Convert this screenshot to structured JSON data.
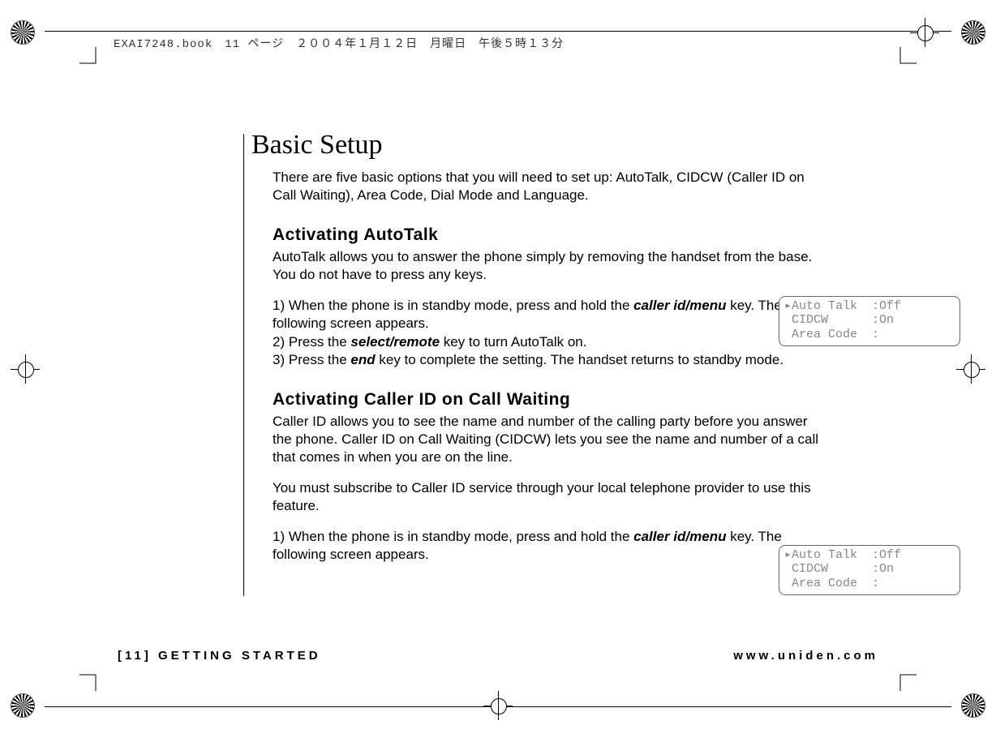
{
  "meta_header": "EXAI7248.book　11 ページ　２００４年１月１２日　月曜日　午後５時１３分",
  "title": "Basic Setup",
  "intro": "There are five basic options that you will need to set up: AutoTalk, CIDCW (Caller ID on Call Waiting), Area Code, Dial Mode and Language.",
  "section1": {
    "heading": "Activating AutoTalk",
    "para": "AutoTalk allows you to answer the phone simply by removing the handset from the base. You do not have to press any keys.",
    "steps": [
      {
        "n": "1)",
        "pre": "When the phone is in standby mode, press and hold the ",
        "key": "caller id/menu",
        "post": " key. The following screen appears."
      },
      {
        "n": "2)",
        "pre": "Press the ",
        "key": "select/remote",
        "post": " key to turn AutoTalk on."
      },
      {
        "n": "3)",
        "pre": "Press the ",
        "key": "end",
        "post": " key to complete the setting. The handset returns to standby mode."
      }
    ]
  },
  "section2": {
    "heading": "Activating Caller ID on Call Waiting",
    "para1": "Caller ID allows you to see the name and number of the calling party before you answer the phone. Caller ID on Call Waiting (CIDCW) lets you see the name and number of a call that comes in when you are on the line.",
    "para2": "You must subscribe to Caller ID service through your local telephone provider to use this feature.",
    "steps": [
      {
        "n": "1)",
        "pre": "When the phone is in standby mode, press and hold the ",
        "key": "caller id/menu",
        "post": " key. The following screen appears."
      }
    ]
  },
  "lcd": {
    "line1": "▸Auto Talk  :Off",
    "line2": " CIDCW      :On",
    "line3": " Area Code  :"
  },
  "footer": {
    "left": "[11] GETTING STARTED",
    "right": "www.uniden.com"
  }
}
